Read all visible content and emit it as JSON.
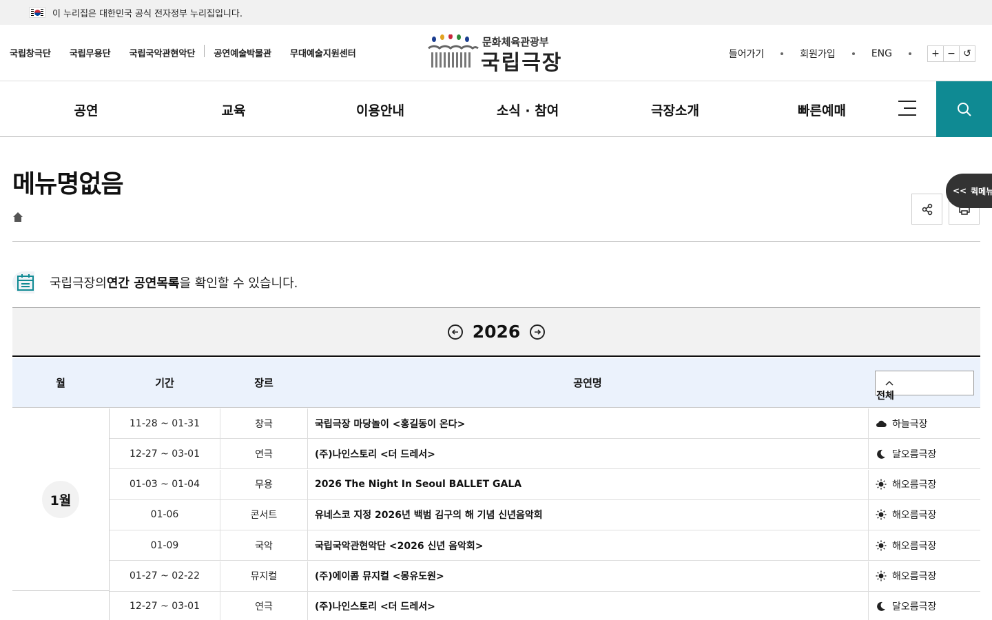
{
  "gov_banner": {
    "text": "이 누리집은 대한민국 공식 전자정부 누리집입니다."
  },
  "family_sites": [
    "국립창극단",
    "국립무용단",
    "국립국악관현악단",
    "공연예술박물관",
    "무대예술지원센터"
  ],
  "logo": {
    "sub": "문화체육관광부",
    "main": "국립극장"
  },
  "util_links": {
    "login": "들어가기",
    "join": "회원가입",
    "lang": "ENG"
  },
  "zoom": {
    "in": "+",
    "out": "−",
    "reset": "↺"
  },
  "gnb": [
    "공연",
    "교육",
    "이용안내",
    "소식 · 참여",
    "극장소개",
    "빠른예매"
  ],
  "page": {
    "title": "메뉴명없음"
  },
  "quick_menu": {
    "label": "퀵메뉴",
    "arrow": "<<"
  },
  "intro": {
    "before": "국립극장의 ",
    "bold": "연간 공연목록",
    "after": "을 확인할 수 있습니다."
  },
  "year": "2026",
  "table": {
    "headers": {
      "month": "월",
      "period": "기간",
      "genre": "장르",
      "title": "공연명"
    },
    "filter": "전체",
    "month_label": "1월",
    "rows": [
      {
        "period": "11-28 ~ 01-31",
        "genre": "창극",
        "title": "국립극장 마당놀이 <홍길동이 온다>",
        "venue": "하늘극장",
        "icon": "cloud"
      },
      {
        "period": "12-27 ~ 03-01",
        "genre": "연극",
        "title": "(주)나인스토리 <더 드레서>",
        "venue": "달오름극장",
        "icon": "moon"
      },
      {
        "period": "01-03 ~ 01-04",
        "genre": "무용",
        "title": "2026 The Night In Seoul BALLET GALA",
        "venue": "해오름극장",
        "icon": "sun"
      },
      {
        "period": "01-06",
        "genre": "콘서트",
        "title": "유네스코 지정 2026년 백범 김구의 해 기념 신년음악회",
        "venue": "해오름극장",
        "icon": "sun"
      },
      {
        "period": "01-09",
        "genre": "국악",
        "title": "국립국악관현악단 <2026 신년 음악회>",
        "venue": "해오름극장",
        "icon": "sun"
      },
      {
        "period": "01-27 ~ 02-22",
        "genre": "뮤지컬",
        "title": "(주)에이콤 뮤지컬 <몽유도원>",
        "venue": "해오름극장",
        "icon": "sun"
      },
      {
        "period": "12-27 ~ 03-01",
        "genre": "연극",
        "title": "(주)나인스토리 <더 드레서>",
        "venue": "달오름극장",
        "icon": "moon"
      }
    ]
  }
}
